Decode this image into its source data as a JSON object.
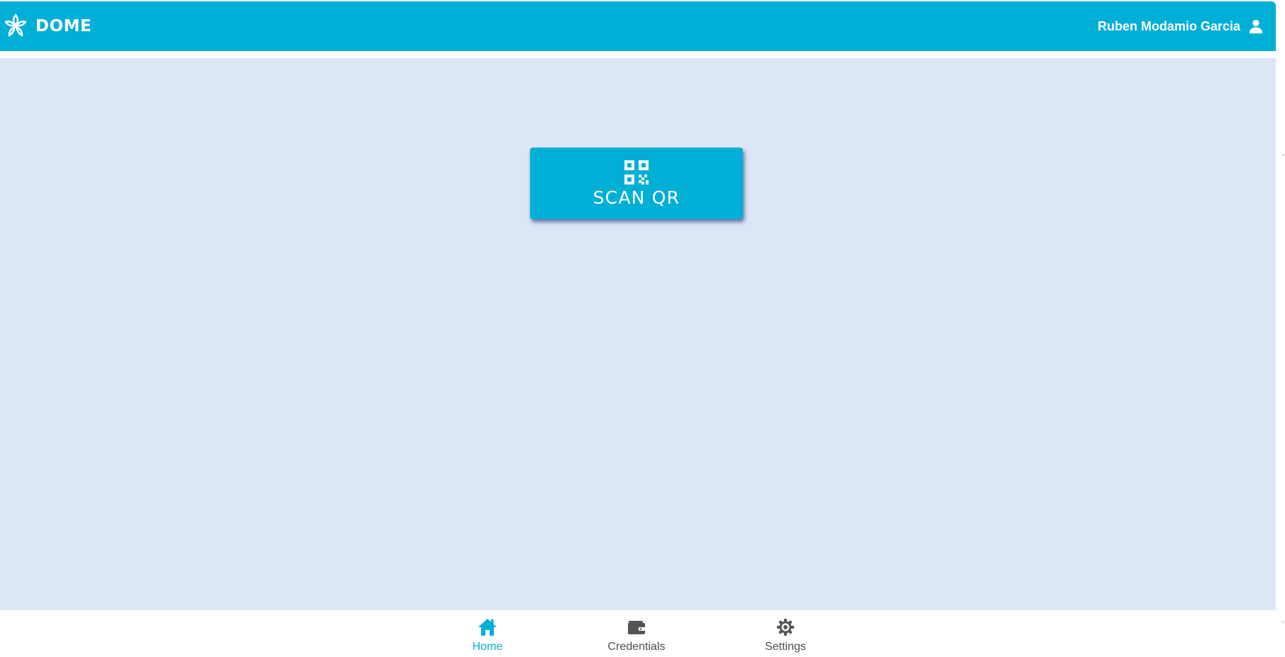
{
  "header": {
    "brand_name": "DOME",
    "brand_logo_icon": "dome-logo-icon",
    "user_name": "Ruben Modamio Garcia",
    "user_icon": "person-icon"
  },
  "main": {
    "scan_button": {
      "label": "SCAN QR",
      "icon": "qr-code-icon"
    }
  },
  "bottom_nav": {
    "items": [
      {
        "label": "Home",
        "icon": "home-icon",
        "active": true
      },
      {
        "label": "Credentials",
        "icon": "wallet-icon",
        "active": false
      },
      {
        "label": "Settings",
        "icon": "gear-icon",
        "active": false
      }
    ]
  },
  "colors": {
    "primary": "#00afd6",
    "background": "#dce6f7",
    "nav_inactive": "#4d4d4d"
  }
}
